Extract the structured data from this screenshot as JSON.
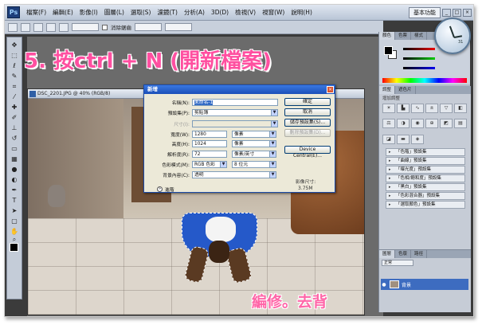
{
  "app": {
    "menu": [
      "檔案(F)",
      "編輯(E)",
      "影像(I)",
      "圖層(L)",
      "選取(S)",
      "濾鏡(T)",
      "分析(A)",
      "3D(D)",
      "檢視(V)",
      "視窗(W)",
      "說明(H)"
    ],
    "workspace_label": "基本功能",
    "window_buttons": [
      "_",
      "□",
      "×"
    ]
  },
  "options_bar": {
    "antialias_label": "消除鋸齒"
  },
  "document": {
    "title": "DSC_2201.JPG @ 40% (RGB/8)"
  },
  "overlay": {
    "step_caption": "5. 按ctrl + N (開新檔案)",
    "credit": "編修。去背"
  },
  "dialog": {
    "title": "新增",
    "close": "×",
    "name_label": "名稱(N):",
    "name_value": "未命名-1",
    "preset_label": "預設集(P):",
    "preset_value": "剪貼簿",
    "size_label": "尺寸(I):",
    "width_label": "寬度(W):",
    "width_value": "1280",
    "width_unit": "像素",
    "height_label": "高度(H):",
    "height_value": "1024",
    "height_unit": "像素",
    "resolution_label": "解析度(R):",
    "resolution_value": "72",
    "resolution_unit": "像素/英寸",
    "color_mode_label": "色彩模式(M):",
    "color_mode_value": "RGB 色彩",
    "bit_depth_value": "8 位元",
    "background_label": "背景內容(C):",
    "background_value": "透明",
    "advanced_label": "進階",
    "buttons": {
      "ok": "確定",
      "cancel": "取消",
      "save_preset": "儲存預設集(S)...",
      "delete_preset": "刪除預設集(D)...",
      "device_central": "Device Central(E)..."
    },
    "image_size_label": "影像尺寸:",
    "image_size_value": "3.75M"
  },
  "panels": {
    "color_tabs": [
      "顏色",
      "色票",
      "樣式"
    ],
    "adjust_tabs": [
      "調整",
      "遮色片"
    ],
    "add_adjustment_label": "增加調整",
    "presets": [
      "「色階」預設集",
      "「曲線」預設集",
      "「曝光度」預設集",
      "「色相/飽和度」預設集",
      "「黑白」預設集",
      "「色彩混合器」預設集",
      "「選取顏色」預設集"
    ],
    "layers_tabs": [
      "圖層",
      "色版",
      "路徑"
    ],
    "blend_mode": "正常",
    "layer_name": "背景",
    "clock_date": "31"
  },
  "colors": {
    "caption": "#ff4fa0",
    "dialog_title": "#1b4fb8",
    "selection": "#316ac5"
  }
}
